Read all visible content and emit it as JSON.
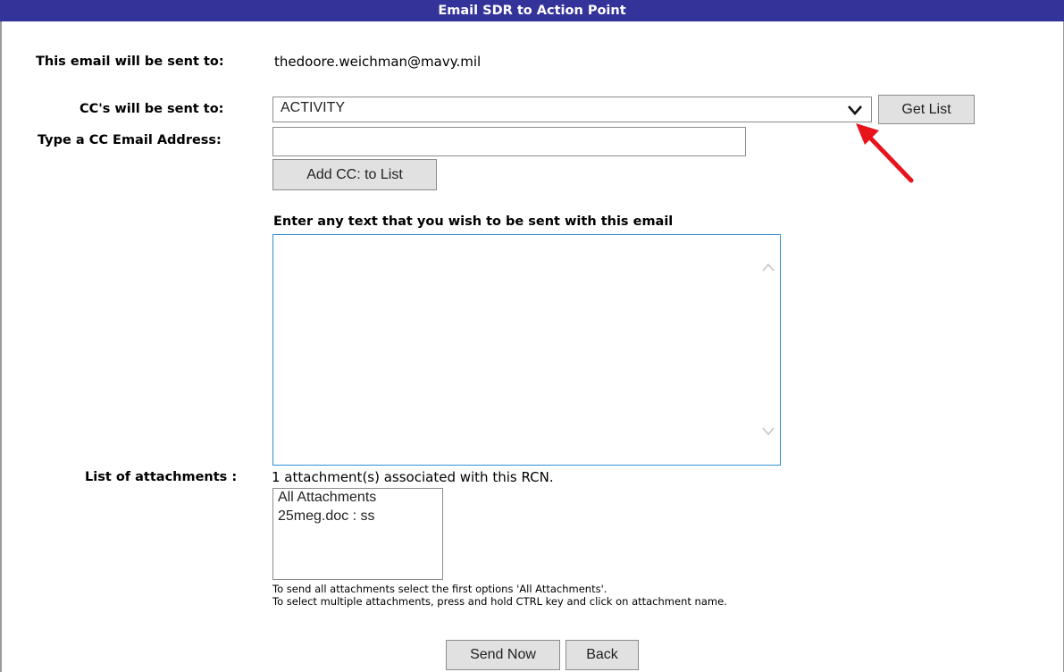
{
  "header": {
    "title": "Email SDR to Action Point"
  },
  "recipient": {
    "label": "This email will be sent to:",
    "email": "thedoore.weichman@mavy.mil"
  },
  "cc": {
    "label": "CC's will be sent to:",
    "selected": "ACTIVITY",
    "get_list_label": "Get List",
    "type_label": "Type a CC Email Address:",
    "input_value": "",
    "add_label": "Add CC: to List"
  },
  "message": {
    "prompt": "Enter any text that you wish to be sent with this email",
    "value": ""
  },
  "attachments": {
    "label": "List of attachments :",
    "summary": "1 attachment(s) associated with this RCN.",
    "options": [
      "All Attachments",
      "25meg.doc : ss"
    ],
    "note_1": "To send all attachments select the first options 'All Attachments'.",
    "note_2": "To select multiple attachments, press and hold CTRL key and click on attachment name."
  },
  "actions": {
    "send_label": "Send Now",
    "back_label": "Back"
  },
  "colors": {
    "title_bar": "#33339a",
    "annotation_arrow": "#e8141c",
    "textarea_focus": "#2f8fd6"
  },
  "icons": {
    "dropdown": "chevron-down-icon",
    "scroll_up": "chevron-up-icon",
    "scroll_down": "chevron-down-icon",
    "annotation": "red-arrow"
  }
}
